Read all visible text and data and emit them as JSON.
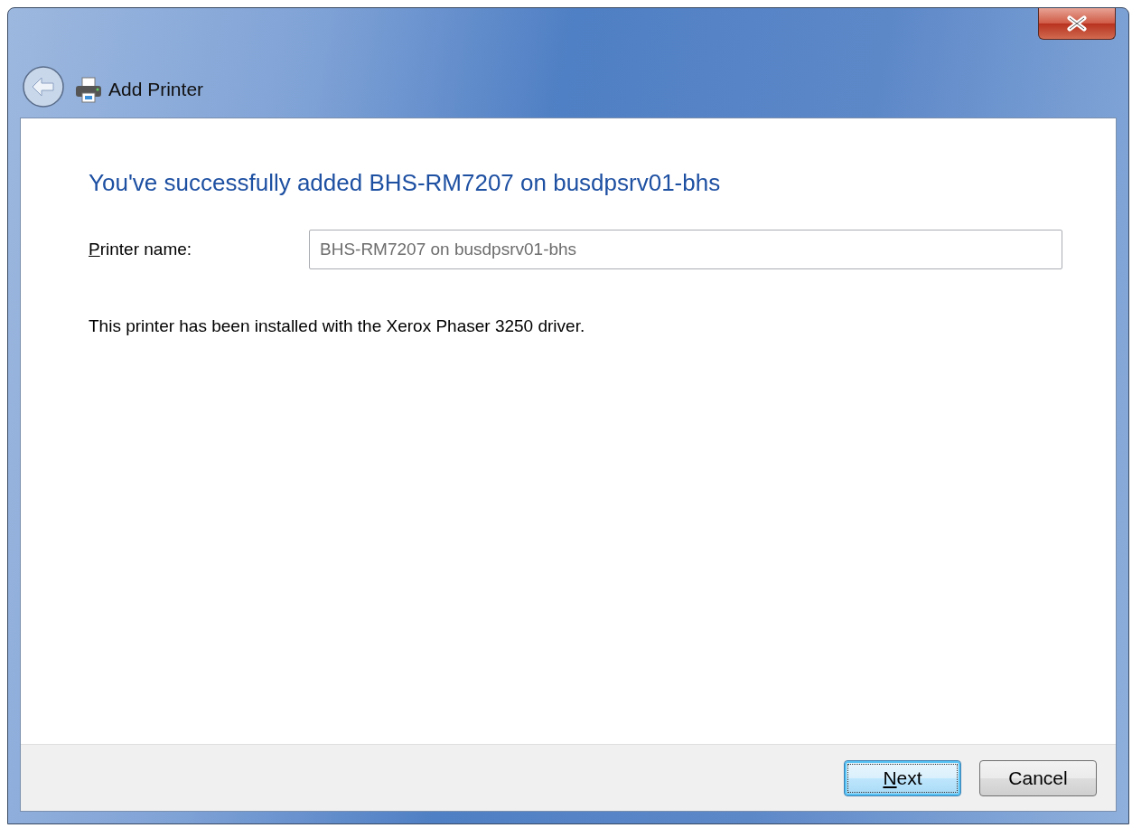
{
  "window": {
    "title": "Add Printer"
  },
  "heading": "You've successfully added BHS-RM7207 on busdpsrv01-bhs",
  "printer_name": {
    "label": "Printer name:",
    "first_letter_underlined": true,
    "value": "BHS-RM7207 on busdpsrv01-bhs",
    "disabled": true
  },
  "message": "This printer has been installed with the Xerox Phaser 3250 driver.",
  "buttons": [
    {
      "label": "Next",
      "first_letter_underlined": true,
      "default": true
    },
    {
      "label": "Cancel",
      "first_letter_underlined": false,
      "default": false
    }
  ]
}
